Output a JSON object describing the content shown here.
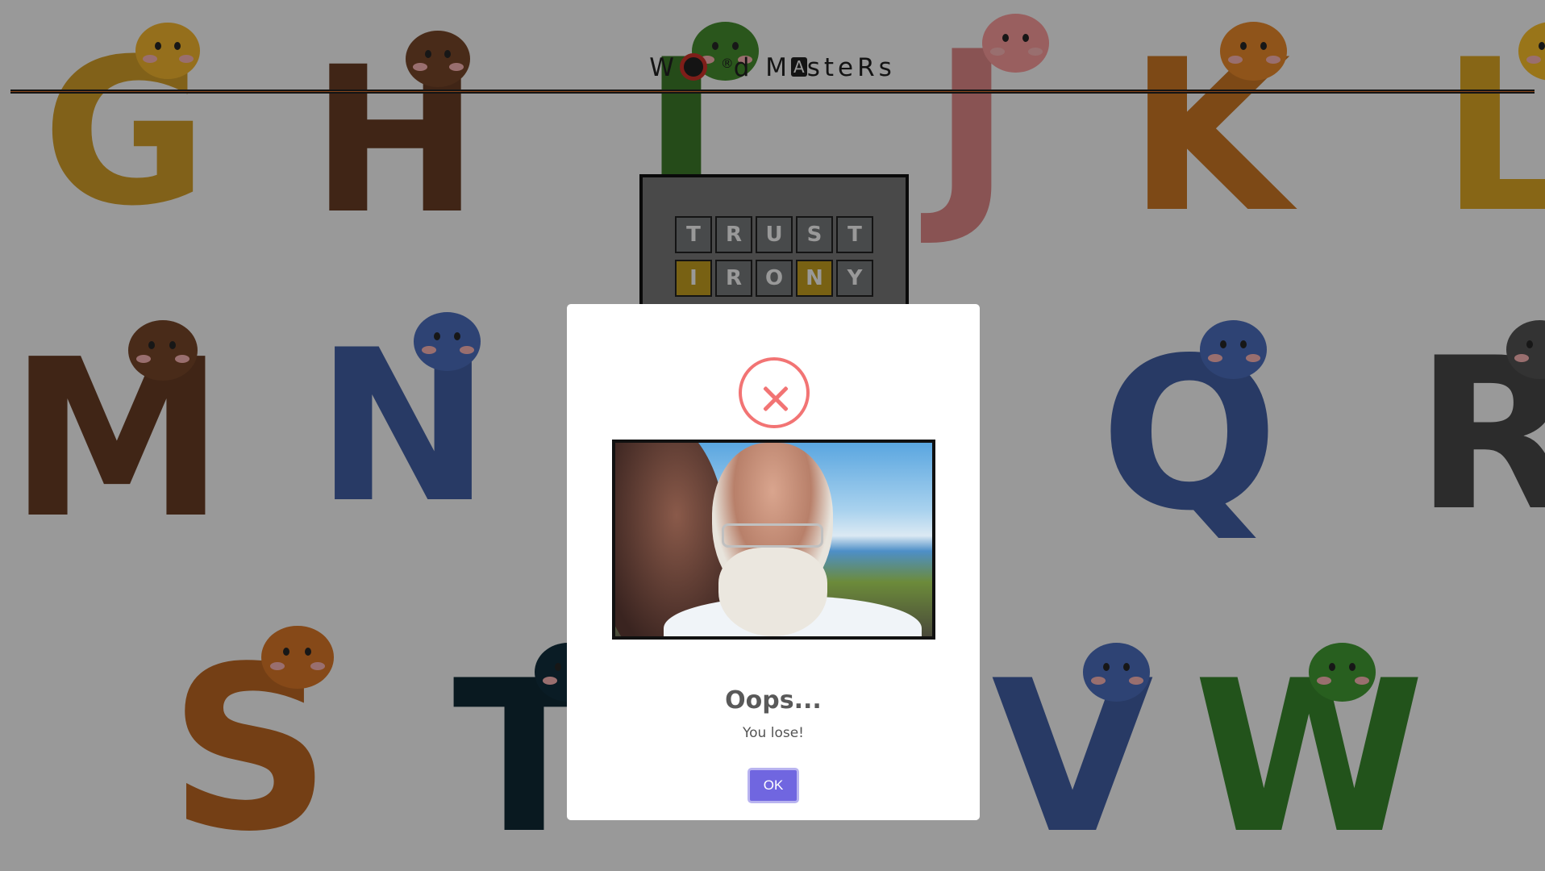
{
  "app": {
    "title_parts": [
      "W",
      "d M",
      "steRs"
    ],
    "title_registered": "®",
    "title_boxed_letter": "A"
  },
  "background": {
    "letters": [
      {
        "char": "G",
        "color": "#d8a22a",
        "icon": "giraffe-icon"
      },
      {
        "char": "H",
        "color": "#6b3f25",
        "icon": "horse-icon"
      },
      {
        "char": "I",
        "color": "#3e7d2a",
        "icon": "lizard-icon"
      },
      {
        "char": "J",
        "color": "#e48a8a",
        "icon": "jellyfish-icon"
      },
      {
        "char": "K",
        "color": "#d07a26",
        "icon": "kangaroo-icon"
      },
      {
        "char": "L",
        "color": "#e2aa25",
        "icon": "lion-icon"
      },
      {
        "char": "M",
        "color": "#6b3f25",
        "icon": "monkey-icon"
      },
      {
        "char": "N",
        "color": "#4462a8",
        "icon": "narwhal-icon"
      },
      {
        "char": "Q",
        "color": "#4462a8",
        "icon": "bird-icon"
      },
      {
        "char": "R",
        "color": "#4a4a4a",
        "icon": "raccoon-icon"
      },
      {
        "char": "S",
        "color": "#c26a24",
        "icon": "scorpion-icon"
      },
      {
        "char": "T",
        "color": "#0f2a36",
        "icon": "toucan-icon"
      },
      {
        "char": "V",
        "color": "#4462a8",
        "icon": "bat-icon"
      },
      {
        "char": "W",
        "color": "#3a8a2e",
        "icon": "snake-icon"
      }
    ]
  },
  "board": {
    "rows": [
      {
        "tiles": [
          {
            "letter": "T",
            "state": "absent"
          },
          {
            "letter": "R",
            "state": "absent"
          },
          {
            "letter": "U",
            "state": "absent"
          },
          {
            "letter": "S",
            "state": "absent"
          },
          {
            "letter": "T",
            "state": "absent"
          }
        ]
      },
      {
        "tiles": [
          {
            "letter": "I",
            "state": "present"
          },
          {
            "letter": "R",
            "state": "absent"
          },
          {
            "letter": "O",
            "state": "absent"
          },
          {
            "letter": "N",
            "state": "present"
          },
          {
            "letter": "Y",
            "state": "absent"
          }
        ]
      }
    ]
  },
  "modal": {
    "icon": "error-x-icon",
    "title": "Oops...",
    "text": "You lose!",
    "ok_label": "OK"
  },
  "colors": {
    "tile_absent": "#787c7e",
    "tile_present": "#c9a220",
    "error": "#f27474",
    "confirm_button": "#7066e0",
    "header_line": "#e2742c"
  }
}
